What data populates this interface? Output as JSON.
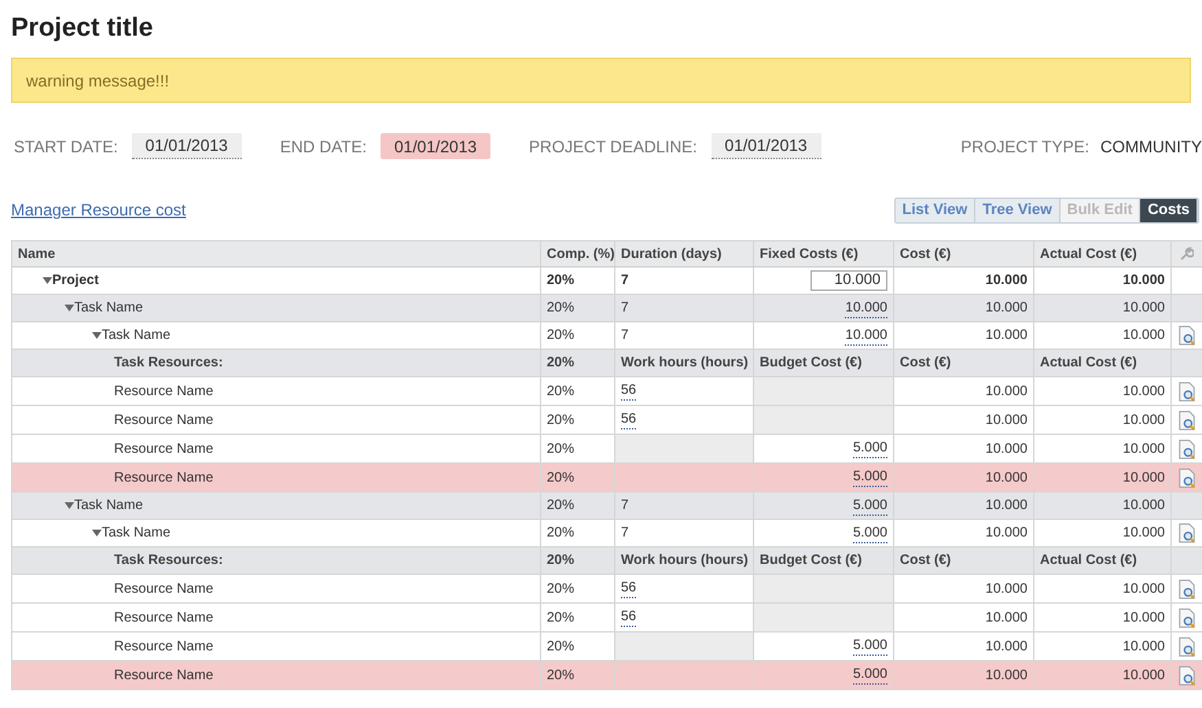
{
  "title": "Project title",
  "warning": "warning message!!!",
  "dates": [
    {
      "label": "START DATE:",
      "value": "01/01/2013",
      "alert": false
    },
    {
      "label": "END DATE:",
      "value": "01/01/2013",
      "alert": true
    },
    {
      "label": "PROJECT DEADLINE:",
      "value": "01/01/2013",
      "alert": false
    }
  ],
  "project_type": {
    "label": "PROJECT TYPE:",
    "value": "COMMUNITY"
  },
  "link": "Manager Resource cost",
  "views": [
    {
      "label": "List View",
      "selected": false,
      "disabled": false
    },
    {
      "label": "Tree View",
      "selected": false,
      "disabled": false
    },
    {
      "label": "Bulk Edit",
      "selected": false,
      "disabled": true
    },
    {
      "label": "Costs",
      "selected": true,
      "disabled": false
    }
  ],
  "table": {
    "columns": [
      "Name",
      "Comp. (%)",
      "Duration (days)",
      "Fixed Costs (€)",
      "Cost (€)",
      "Actual Cost (€)"
    ],
    "rows": [
      {
        "kind": "project",
        "name": "Project",
        "expanded": true,
        "comp": "20%",
        "duration": "7",
        "fixed_cost": "10.000",
        "cost": "10.000",
        "actual_cost": "10.000",
        "details": false,
        "children": [
          {
            "kind": "task",
            "name": "Task Name",
            "expanded": true,
            "comp": "20%",
            "duration": "7",
            "fixed_cost": "10.000",
            "cost": "10.000",
            "actual_cost": "10.000",
            "details": false,
            "children": [
              {
                "kind": "subtask",
                "name": "Task Name",
                "expanded": true,
                "comp": "20%",
                "duration": "7",
                "fixed_cost": "10.000",
                "cost": "10.000",
                "actual_cost": "10.000",
                "details": true,
                "resources_header": [
                  "Task Resources:",
                  "20%",
                  "Work hours (hours)",
                  "Budget Cost (€)",
                  "Cost (€)",
                  "Actual Cost (€)"
                ],
                "resources": [
                  {
                    "name": "Resource Name",
                    "comp": "20%",
                    "work_hours": "56",
                    "cost": "10.000",
                    "actual_cost": "10.000",
                    "alert": false
                  },
                  {
                    "name": "Resource Name",
                    "comp": "20%",
                    "work_hours": "56",
                    "cost": "10.000",
                    "actual_cost": "10.000",
                    "alert": false
                  },
                  {
                    "name": "Resource Name",
                    "comp": "20%",
                    "budget_cost": "5.000",
                    "cost": "10.000",
                    "actual_cost": "10.000",
                    "alert": false
                  },
                  {
                    "name": "Resource Name",
                    "comp": "20%",
                    "budget_cost": "5.000",
                    "cost": "10.000",
                    "actual_cost": "10.000",
                    "alert": true
                  }
                ]
              }
            ]
          },
          {
            "kind": "task",
            "name": "Task Name",
            "expanded": true,
            "comp": "20%",
            "duration": "7",
            "fixed_cost": "5.000",
            "cost": "10.000",
            "actual_cost": "10.000",
            "details": false,
            "children": [
              {
                "kind": "subtask",
                "name": "Task Name",
                "expanded": true,
                "comp": "20%",
                "duration": "7",
                "fixed_cost": "5.000",
                "cost": "10.000",
                "actual_cost": "10.000",
                "details": true,
                "resources_header": [
                  "Task Resources:",
                  "20%",
                  "Work hours (hours)",
                  "Budget Cost (€)",
                  "Cost (€)",
                  "Actual Cost (€)"
                ],
                "resources": [
                  {
                    "name": "Resource Name",
                    "comp": "20%",
                    "work_hours": "56",
                    "cost": "10.000",
                    "actual_cost": "10.000",
                    "alert": false
                  },
                  {
                    "name": "Resource Name",
                    "comp": "20%",
                    "work_hours": "56",
                    "cost": "10.000",
                    "actual_cost": "10.000",
                    "alert": false
                  },
                  {
                    "name": "Resource Name",
                    "comp": "20%",
                    "budget_cost": "5.000",
                    "cost": "10.000",
                    "actual_cost": "10.000",
                    "alert": false
                  },
                  {
                    "name": "Resource Name",
                    "comp": "20%",
                    "budget_cost": "5.000",
                    "cost": "10.000",
                    "actual_cost": "10.000",
                    "alert": true
                  }
                ]
              }
            ]
          }
        ]
      }
    ]
  }
}
